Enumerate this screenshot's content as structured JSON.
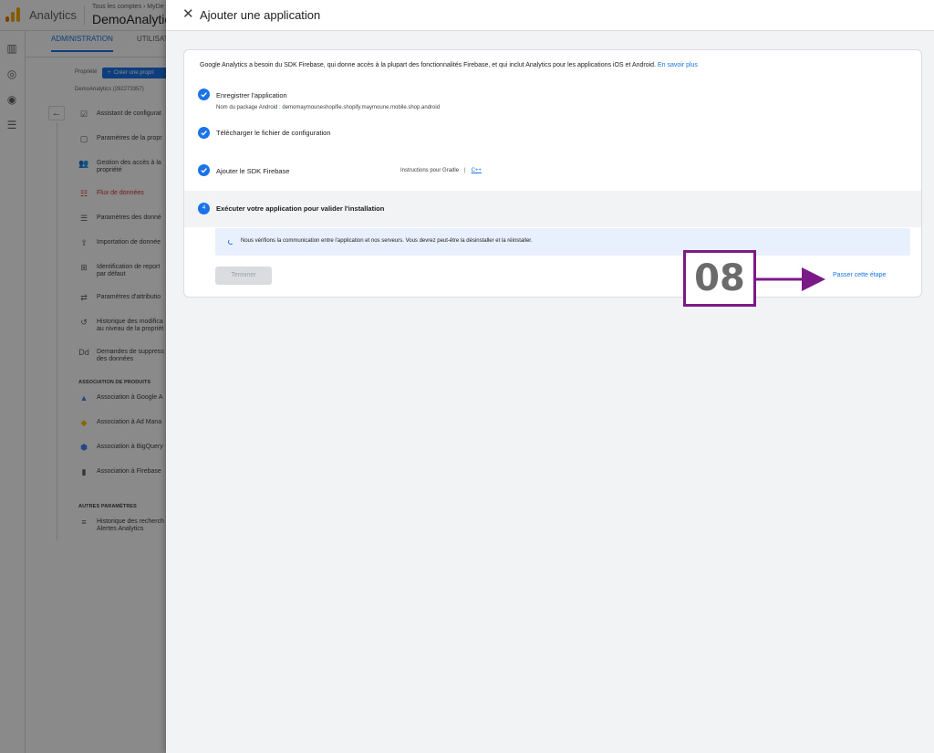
{
  "background": {
    "app_name": "Analytics",
    "account_crumb": "Tous les comptes › MyDe",
    "account_name": "DemoAnalytic",
    "tabs": [
      "ADMINISTRATION",
      "UTILISAT"
    ],
    "property_label": "Propriété",
    "create_property": "Créer une propri",
    "property_id": "DemoAnalytics (292273357)",
    "menu": [
      {
        "icon": "checklist-icon",
        "label": "Assistant de configurat"
      },
      {
        "icon": "settings-square-icon",
        "label": "Paramètres de la propr"
      },
      {
        "icon": "people-icon",
        "label": "Gestion des accès à la propriété"
      },
      {
        "icon": "data-streams-icon",
        "label": "Flux de données",
        "active": true
      },
      {
        "icon": "database-icon",
        "label": "Paramètres des donné"
      },
      {
        "icon": "upload-icon",
        "label": "Importation de donnée"
      },
      {
        "icon": "reporting-identity-icon",
        "label": "Identification de report par défaut"
      },
      {
        "icon": "attribution-icon",
        "label": "Paramètres d'attributio"
      },
      {
        "icon": "history-icon",
        "label": "Historique des modifica au niveau de la propriét"
      },
      {
        "icon": "data-deletion-icon",
        "label": "Demandes de suppress des données"
      }
    ],
    "product_links_header": "ASSOCIATION DE PRODUITS",
    "product_links": [
      {
        "icon": "google-ads-icon",
        "label": "Association à Google A"
      },
      {
        "icon": "ad-manager-icon",
        "label": "Association à Ad Mana"
      },
      {
        "icon": "bigquery-icon",
        "label": "Association à BigQuery"
      },
      {
        "icon": "firebase-icon",
        "label": "Association à Firebase"
      }
    ],
    "other_settings_header": "AUTRES PARAMÈTRES",
    "other_settings": [
      {
        "icon": "search-history-icon",
        "label": "Historique des recherch Alertes Analytics"
      }
    ]
  },
  "dialog": {
    "title": "Ajouter une application",
    "intro": "Google Analytics a besoin du SDK Firebase, qui donne accès à la plupart des fonctionnalités Firebase, et qui inclut Analytics pour les applications iOS et Android.",
    "learn_more": "En savoir plus",
    "steps": [
      {
        "title": "Enregistrer l'application",
        "subtitle": "Nom du package Android : demomaymouneshopifie.shopify.maymoune.mobile.shop.android",
        "done": true
      },
      {
        "title": "Télécharger le fichier de configuration",
        "done": true
      },
      {
        "title": "Ajouter le SDK Firebase",
        "done": true,
        "instructions": "Instructions pour Gradle",
        "separator": "|",
        "cpp_link": "C++"
      },
      {
        "number": "4",
        "title": "Exécuter votre application pour valider l'installation",
        "done": false
      }
    ],
    "info_message": "Nous vérifions la communication entre l'application et nos serveurs. Vous devrez peut-être la désinstaller et la réinstaller.",
    "finish_button": "Terminer",
    "skip_link": "Passer cette étape"
  },
  "annotation": {
    "number": "08",
    "color": "#7b1a86"
  },
  "colors": {
    "accent": "#1a73e8",
    "active_menu": "#d93025",
    "panel_bg": "#f1f3f4"
  }
}
